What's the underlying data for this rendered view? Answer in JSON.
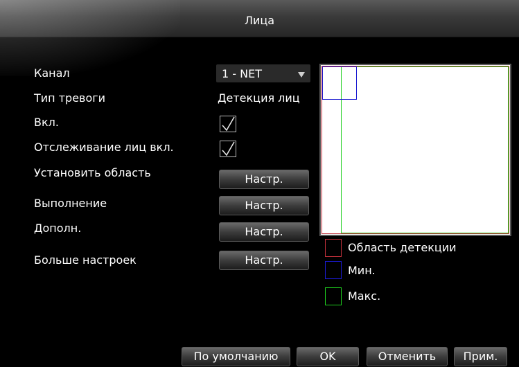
{
  "window": {
    "title": "Лица"
  },
  "form": {
    "channel": {
      "label": "Канал",
      "value": "1 - NET"
    },
    "alarm_type": {
      "label": "Тип тревоги",
      "value": "Детекция лиц"
    },
    "enable": {
      "label": "Вкл.",
      "checked": true
    },
    "tracking": {
      "label": "Отслеживание лиц вкл.",
      "checked": true
    },
    "set_area": {
      "label": "Установить область",
      "button": "Настр."
    },
    "perform": {
      "label": "Выполнение",
      "button": "Настр."
    },
    "extra": {
      "label": "Дополн.",
      "button": "Настр."
    },
    "more": {
      "label": "Больше настроек",
      "button": "Настр."
    }
  },
  "legend": {
    "detection": {
      "label": "Область детекции",
      "color": "#c0303b"
    },
    "min": {
      "label": "Мин.",
      "color": "#1a1ad0"
    },
    "max": {
      "label": "Макс.",
      "color": "#1fcf1f"
    }
  },
  "footer": {
    "default": "По умолчанию",
    "ok": "OK",
    "cancel": "Отменить",
    "apply": "Прим."
  },
  "icons": {
    "dropdown": "dropdown-arrow-icon",
    "check": "checkmark-icon"
  }
}
